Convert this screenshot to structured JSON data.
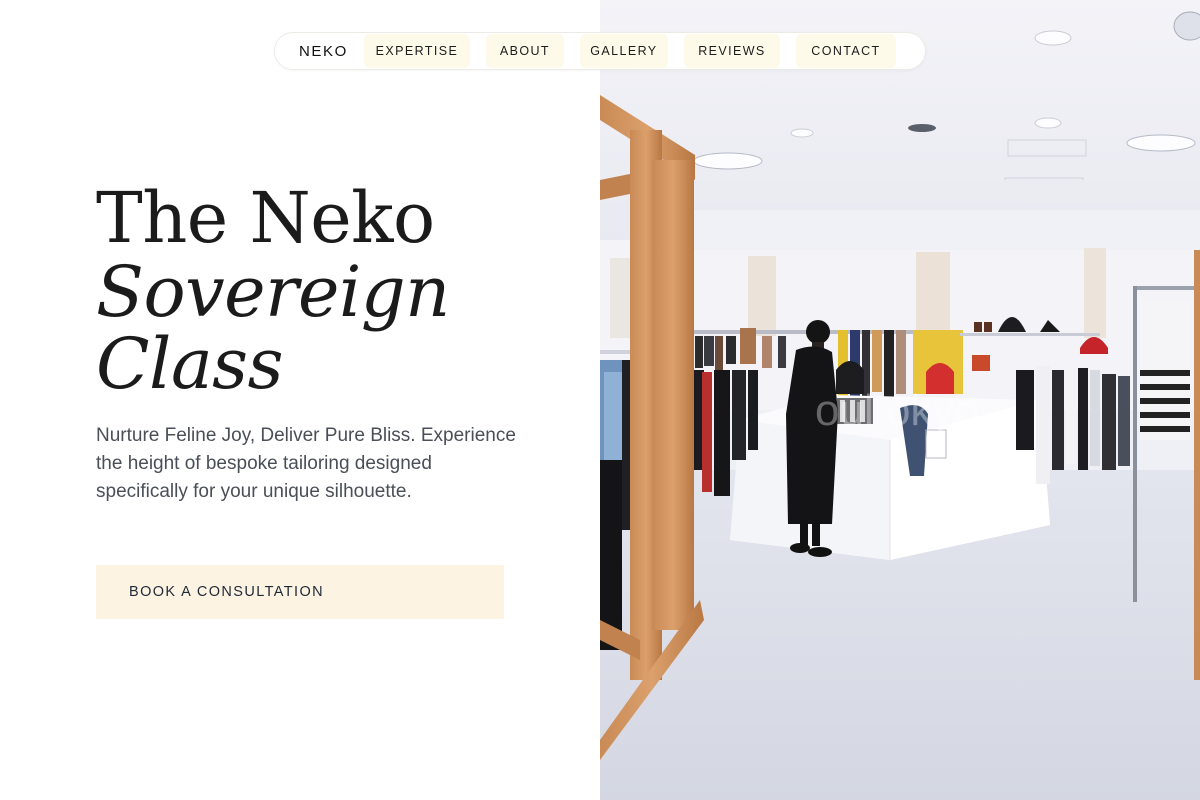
{
  "nav": {
    "brand": "NEKO",
    "links": [
      "EXPERTISE",
      "ABOUT",
      "GALLERY",
      "REVIEWS",
      "CONTACT"
    ]
  },
  "hero": {
    "title_line1": "The Neko",
    "title_line2": "Sovereign",
    "title_line3": "Class",
    "subtitle": "Nurture Feline Joy, Deliver Pure Bliss. Experience the height of bespoke tailoring designed specifically for your unique silhouette.",
    "cta_label": "BOOK A CONSULTATION"
  },
  "photo": {
    "watermark": "oul okyo"
  },
  "colors": {
    "cta_bg": "#fdf3e3",
    "nav_link_bg": "#fdfaea",
    "text_dark": "#1b1b1b",
    "text_muted": "#4a4f57"
  }
}
